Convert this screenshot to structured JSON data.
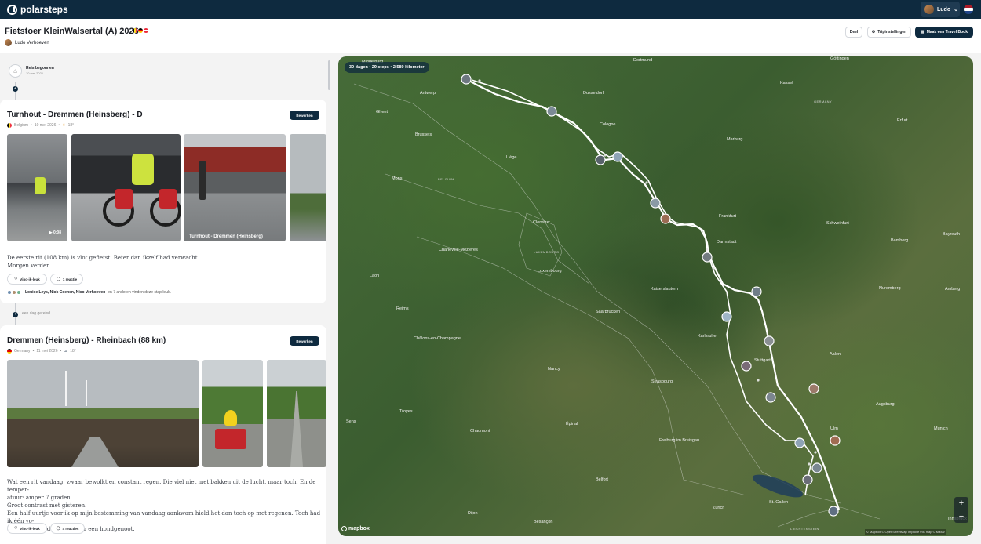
{
  "app": {
    "brand": "polarsteps"
  },
  "topbar": {
    "user_name": "Ludo"
  },
  "trip": {
    "title": "Fietstoer KleinWalsertal (A) 2026",
    "author": "Ludo Verhoeven",
    "actions": {
      "share": "Deel",
      "settings": "Tripinstellingen",
      "travel_book": "Maak een Travel Book"
    }
  },
  "timeline": {
    "start": {
      "title": "Reis begonnen",
      "date": "10 mei 2026"
    },
    "gap_label": "een dag gereisd"
  },
  "steps": [
    {
      "title": "Turnhout - Dremmen (Heinsberg) - D",
      "country": "Belgium",
      "date": "10 mei 2026",
      "temperature": "18°",
      "edit_label": "Bewerken",
      "video_duration": "0:08",
      "photo_caption": "Turnhout - Dremmen (Heinsberg)",
      "description": [
        "De eerste rit (108 km) is vlot gefietst. Beter dan ikzelf had verwacht.",
        "Morgen verder ..."
      ],
      "like_label": "Vind-ik-leuk",
      "comment_label": "1 reactie",
      "likers": "Louise Leys, Nick Coenen, Nico Verhoeven",
      "likers_suffix": "en 7 anderen vinden deze stap leuk."
    },
    {
      "title": "Dremmen (Heinsberg) - Rheinbach (88 km)",
      "country": "Germany",
      "date": "11 mei 2026",
      "temperature": "18°",
      "edit_label": "Bewerken",
      "description": [
        "Wat een rit vandaag: zwaar bewolkt en constant regen. Die viel niet met bakken uit de lucht, maar toch. En de temper-",
        "atuur: amper 7 graden...",
        "Groot contrast met gisteren.",
        "Een half uurtje voor ik op mijn bestemming van vandaag aankwam hield het dan toch op met regenen. Toch had ik één vo-",
        "ordeel: de wind was dit keer een hondgenoot."
      ],
      "like_label": "Vind-ik-leuk",
      "comment_label": "4 reacties"
    }
  ],
  "map": {
    "stats": "30 dagen • 29 steps • 2.580 kilometer",
    "zoom_in": "+",
    "zoom_out": "−",
    "logo": "mapbox",
    "attribution": "© Mapbox © OpenStreetMap Improve this map © Maxar",
    "labels": {
      "cities": [
        "Middelburg",
        "Dortmund",
        "Antwerp",
        "Dusseldorf",
        "Kassel",
        "Göttingen",
        "Ghent",
        "Cologne",
        "Erfurt",
        "Brussels",
        "Liège",
        "Marburg",
        "Mons",
        "Frankfurt",
        "Clervaux",
        "Darmstadt",
        "Schweinfurt",
        "Charleville-Mézières",
        "Luxembourg",
        "Bamberg",
        "Bayreuth",
        "Laon",
        "Kaiserslautern",
        "Nuremberg",
        "Amberg",
        "Reims",
        "Saarbrücken",
        "Karlsruhe",
        "Châlons-en-Champagne",
        "Stuttgart",
        "Aalen",
        "Nancy",
        "Strasbourg",
        "Augsburg",
        "Troyes",
        "Sens",
        "Épinal",
        "Munich",
        "Chaumont",
        "Freiburg im Breisgau",
        "Belfort",
        "Zürich",
        "St. Gallen",
        "Dijon",
        "Besançon",
        "Innsbruck",
        "Ulm"
      ],
      "regions": [
        "BELGIUM",
        "GERMANY",
        "LUXEMBOURG",
        "LIECHTENSTEIN"
      ]
    }
  },
  "colors": {
    "navy": "#0e2a3f",
    "route": "#ffffff"
  }
}
